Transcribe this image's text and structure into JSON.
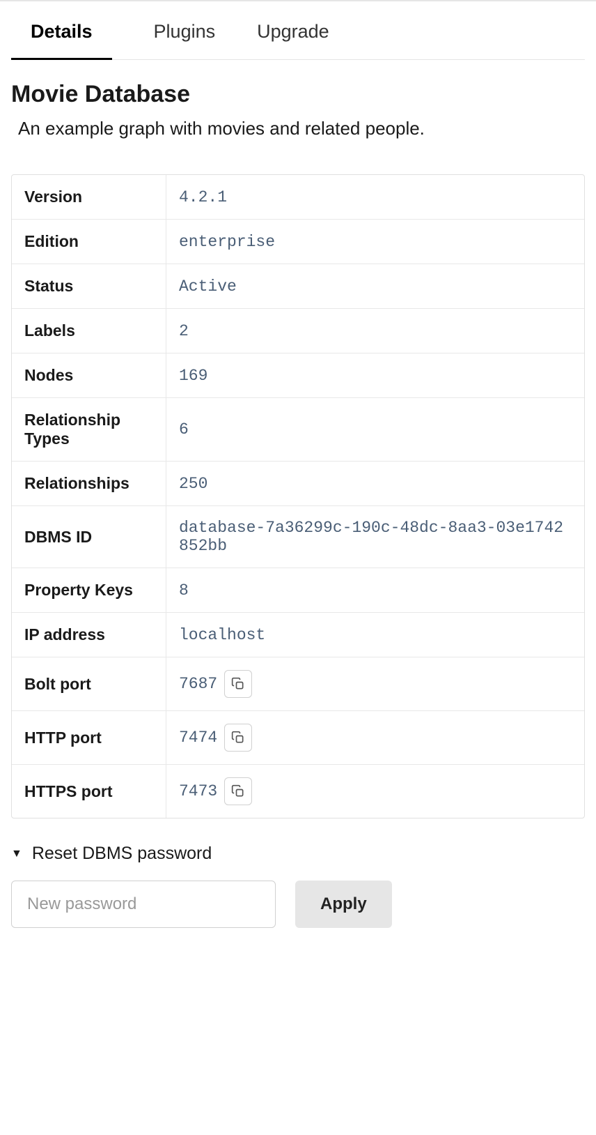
{
  "tabs": [
    {
      "label": "Details",
      "active": true
    },
    {
      "label": "Plugins",
      "active": false
    },
    {
      "label": "Upgrade",
      "active": false
    }
  ],
  "header": {
    "title": "Movie Database",
    "description": "An example graph with movies and related people."
  },
  "details": {
    "rows": [
      {
        "label": "Version",
        "value": "4.2.1",
        "copy": false
      },
      {
        "label": "Edition",
        "value": "enterprise",
        "copy": false
      },
      {
        "label": "Status",
        "value": "Active",
        "copy": false
      },
      {
        "label": "Labels",
        "value": "2",
        "copy": false
      },
      {
        "label": "Nodes",
        "value": "169",
        "copy": false
      },
      {
        "label": "Relationship Types",
        "value": "6",
        "copy": false
      },
      {
        "label": "Relationships",
        "value": "250",
        "copy": false
      },
      {
        "label": "DBMS ID",
        "value": "database-7a36299c-190c-48dc-8aa3-03e1742852bb",
        "copy": false
      },
      {
        "label": "Property Keys",
        "value": "8",
        "copy": false
      },
      {
        "label": "IP address",
        "value": "localhost",
        "copy": false
      },
      {
        "label": "Bolt port",
        "value": "7687",
        "copy": true
      },
      {
        "label": "HTTP port",
        "value": "7474",
        "copy": true
      },
      {
        "label": "HTTPS port",
        "value": "7473",
        "copy": true
      }
    ]
  },
  "reset": {
    "title": "Reset DBMS password",
    "placeholder": "New password",
    "apply_label": "Apply"
  }
}
